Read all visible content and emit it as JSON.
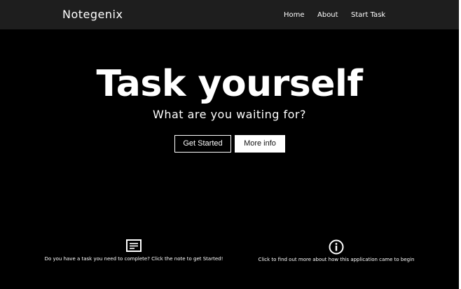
{
  "app": {
    "brand": "Notegenix"
  },
  "nav": {
    "items": [
      {
        "label": "Home"
      },
      {
        "label": "About"
      },
      {
        "label": "Start Task"
      }
    ]
  },
  "hero": {
    "title": "Task yourself",
    "subtitle": "What are you waiting for?",
    "primary_button": "Get Started",
    "secondary_button": "More info"
  },
  "features": [
    {
      "icon": "note-icon",
      "text": "Do you have a task you need to complete? Click the note to get Started!"
    },
    {
      "icon": "info-icon",
      "text": "Click to find out more about how this application came to begin"
    }
  ],
  "colors": {
    "background": "#000000",
    "navbar": "#1e1e1e",
    "text": "#ffffff"
  }
}
